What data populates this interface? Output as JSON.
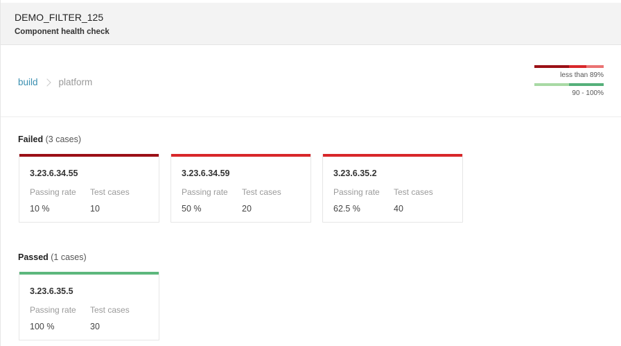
{
  "header": {
    "title": "DEMO_FILTER_125",
    "subtitle": "Component health check"
  },
  "breadcrumb": {
    "link": "build",
    "current": "platform"
  },
  "legend": {
    "fail_label": "less than 89%",
    "pass_label": "90 - 100%",
    "fail_colors": [
      "#9b1016",
      "#d8272a",
      "#ea7373"
    ],
    "pass_colors": [
      "#a8d9a4",
      "#55b07a"
    ]
  },
  "colors": {
    "dark_red": "#9b1016",
    "red": "#d8272a",
    "green": "#5db77d"
  },
  "sections": {
    "failed": {
      "title": "Failed",
      "count": "(3 cases)",
      "cards": [
        {
          "version": "3.23.6.34.55",
          "rate_label": "Passing rate",
          "cases_label": "Test cases",
          "rate": "10 %",
          "cases": "10",
          "color": "#9b1016"
        },
        {
          "version": "3.23.6.34.59",
          "rate_label": "Passing rate",
          "cases_label": "Test cases",
          "rate": "50 %",
          "cases": "20",
          "color": "#d8272a"
        },
        {
          "version": "3.23.6.35.2",
          "rate_label": "Passing rate",
          "cases_label": "Test cases",
          "rate": "62.5 %",
          "cases": "40",
          "color": "#d8272a"
        }
      ]
    },
    "passed": {
      "title": "Passed",
      "count": "(1 cases)",
      "cards": [
        {
          "version": "3.23.6.35.5",
          "rate_label": "Passing rate",
          "cases_label": "Test cases",
          "rate": "100 %",
          "cases": "30",
          "color": "#5db77d"
        }
      ]
    }
  }
}
